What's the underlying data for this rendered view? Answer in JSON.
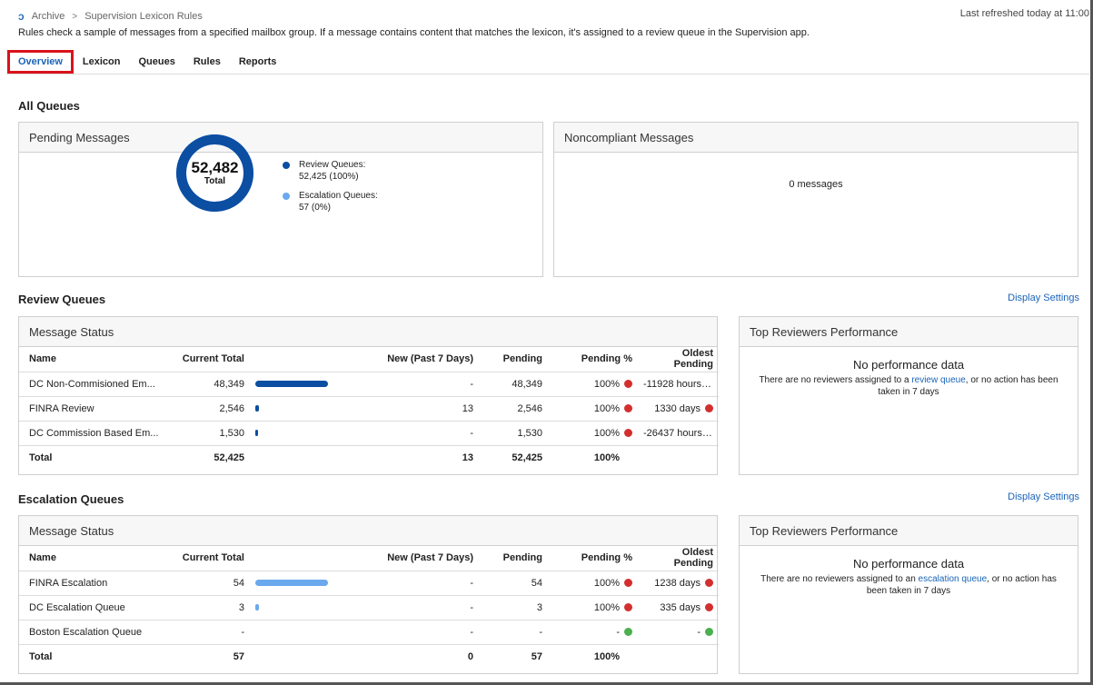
{
  "header": {
    "breadcrumb": [
      "Archive",
      "Supervision Lexicon Rules"
    ],
    "breadcrumb_sep": ">",
    "refresh": "Last refreshed today at 11:00",
    "description": "Rules check a sample of messages from a specified mailbox group. If a message contains content that matches the lexicon, it's assigned to a review queue in the Supervision app."
  },
  "tabs": [
    {
      "label": "Overview",
      "active": true
    },
    {
      "label": "Lexicon",
      "active": false
    },
    {
      "label": "Queues",
      "active": false
    },
    {
      "label": "Rules",
      "active": false
    },
    {
      "label": "Reports",
      "active": false
    }
  ],
  "all_queues": {
    "title": "All Queues",
    "pending": {
      "title": "Pending Messages",
      "total": "52,482",
      "total_label": "Total",
      "review_fraction": 0.999,
      "legend": [
        {
          "label": "Review Queues:",
          "value": "52,425 (100%)",
          "color": "#0b4ea2"
        },
        {
          "label": "Escalation Queues:",
          "value": "57 (0%)",
          "color": "#6aa9ee"
        }
      ]
    },
    "noncompliant": {
      "title": "Noncompliant Messages",
      "message": "0 messages"
    }
  },
  "review_queues": {
    "title": "Review Queues",
    "display_settings": "Display Settings",
    "status_title": "Message Status",
    "bar_color": "#0b4ea2",
    "columns": [
      "Name",
      "Current Total",
      "New (Past 7 Days)",
      "Pending",
      "Pending %",
      "Oldest Pending"
    ],
    "rows": [
      {
        "name": "DC Non-Commisioned Em...",
        "current": "48,349",
        "bar": 1.0,
        "new": "-",
        "pending": "48,349",
        "pct": "100%",
        "pct_color": "#d32f2f",
        "oldest": "-11928 hours",
        "oldest_color": "#d32f2f"
      },
      {
        "name": "FINRA Review",
        "current": "2,546",
        "bar": 0.0527,
        "new": "13",
        "pending": "2,546",
        "pct": "100%",
        "pct_color": "#d32f2f",
        "oldest": "1330 days",
        "oldest_color": "#d32f2f"
      },
      {
        "name": "DC Commission Based Em...",
        "current": "1,530",
        "bar": 0.0316,
        "new": "-",
        "pending": "1,530",
        "pct": "100%",
        "pct_color": "#d32f2f",
        "oldest": "-26437 hours",
        "oldest_color": "#d32f2f"
      }
    ],
    "total": {
      "name": "Total",
      "current": "52,425",
      "new": "13",
      "pending": "52,425",
      "pct": "100%"
    },
    "perf": {
      "title": "Top Reviewers Performance",
      "heading": "No performance data",
      "text_before": "There are no reviewers assigned to a ",
      "link": "review queue",
      "text_after": ", or no action has been taken in 7 days"
    }
  },
  "escalation_queues": {
    "title": "Escalation Queues",
    "display_settings": "Display Settings",
    "status_title": "Message Status",
    "bar_color": "#6aa9ee",
    "columns": [
      "Name",
      "Current Total",
      "New (Past 7 Days)",
      "Pending",
      "Pending %",
      "Oldest Pending"
    ],
    "rows": [
      {
        "name": "FINRA Escalation",
        "current": "54",
        "bar": 1.0,
        "new": "-",
        "pending": "54",
        "pct": "100%",
        "pct_color": "#d32f2f",
        "oldest": "1238 days",
        "oldest_color": "#d32f2f"
      },
      {
        "name": "DC Escalation Queue",
        "current": "3",
        "bar": 0.0556,
        "new": "-",
        "pending": "3",
        "pct": "100%",
        "pct_color": "#d32f2f",
        "oldest": "335 days",
        "oldest_color": "#d32f2f"
      },
      {
        "name": "Boston Escalation Queue",
        "current": "-",
        "bar": 0,
        "new": "-",
        "pending": "-",
        "pct": "-",
        "pct_color": "#4caf50",
        "oldest": "-",
        "oldest_color": "#4caf50"
      }
    ],
    "total": {
      "name": "Total",
      "current": "57",
      "new": "0",
      "pending": "57",
      "pct": "100%"
    },
    "perf": {
      "title": "Top Reviewers Performance",
      "heading": "No performance data",
      "text_before": "There are no reviewers assigned to an ",
      "link": "escalation queue",
      "text_after": ", or no action has been taken in 7 days"
    }
  }
}
